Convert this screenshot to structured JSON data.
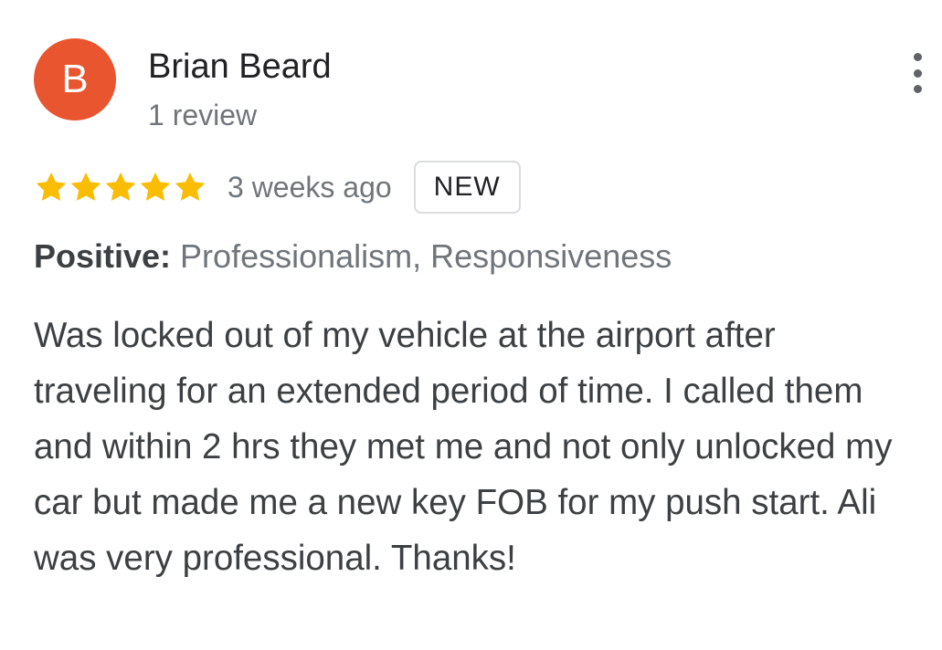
{
  "reviewer": {
    "initial": "B",
    "avatar_color": "#e8552e",
    "name": "Brian Beard",
    "review_count": "1 review"
  },
  "rating": {
    "stars": 5,
    "max_stars": 5,
    "star_color": "#fbbc04"
  },
  "time_ago": "3 weeks ago",
  "badge": "NEW",
  "highlights": {
    "label": "Positive:",
    "value": "Professionalism, Responsiveness"
  },
  "review_text": "Was locked out of my vehicle at the airport after traveling for an extended period of time. I called them and within 2 hrs they met me and not only unlocked my car but made me a new key FOB for my push start. Ali was very professional. Thanks!",
  "icons": {
    "more": "more-vert-icon",
    "star": "star-icon"
  }
}
